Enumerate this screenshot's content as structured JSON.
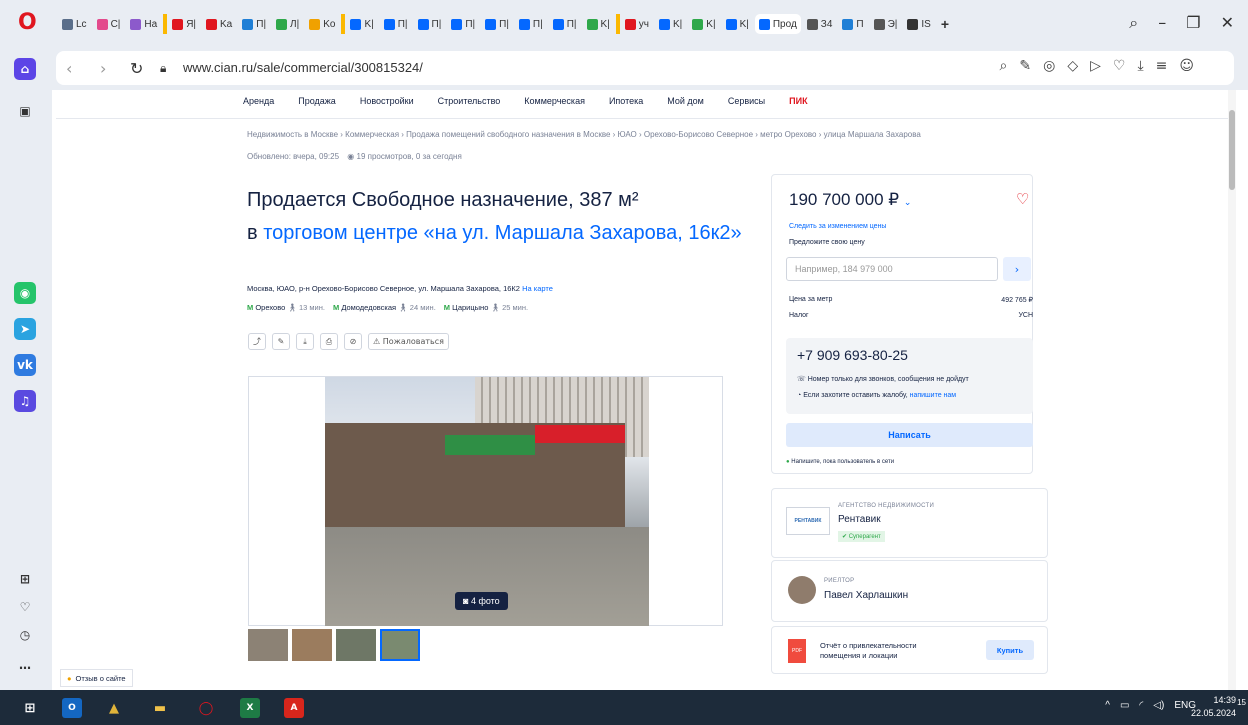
{
  "browser": {
    "tabs": [
      {
        "label": "Lc",
        "color": "#5a6e8a"
      },
      {
        "label": "C|",
        "color": "#e34a8c"
      },
      {
        "label": "Ha",
        "color": "#8c5acb"
      },
      {
        "label": "Я|",
        "color": "#e0161f"
      },
      {
        "label": "Ka",
        "color": "#e0161f"
      },
      {
        "label": "П|",
        "color": "#1f7fd6"
      },
      {
        "label": "Л|",
        "color": "#2ea84a"
      },
      {
        "label": "Ko",
        "color": "#f0a100"
      },
      {
        "label": "K|",
        "color": "#0468ff"
      },
      {
        "label": "П|",
        "color": "#0468ff"
      },
      {
        "label": "П|",
        "color": "#0468ff"
      },
      {
        "label": "П|",
        "color": "#0468ff"
      },
      {
        "label": "П|",
        "color": "#0468ff"
      },
      {
        "label": "П|",
        "color": "#0468ff"
      },
      {
        "label": "П|",
        "color": "#0468ff"
      },
      {
        "label": "K|",
        "color": "#2ea84a"
      },
      {
        "label": "уч",
        "color": "#e0161f"
      },
      {
        "label": "K|",
        "color": "#0468ff"
      },
      {
        "label": "K|",
        "color": "#2ea84a"
      },
      {
        "label": "K|",
        "color": "#0468ff"
      },
      {
        "label": "Прод",
        "color": "#0468ff"
      },
      {
        "label": "З4",
        "color": "#555555"
      },
      {
        "label": "П",
        "color": "#1f7fd6"
      },
      {
        "label": "Э|",
        "color": "#555555"
      },
      {
        "label": "IS",
        "color": "#333333"
      }
    ],
    "url": "www.cian.ru/sale/commercial/300815324/"
  },
  "menu": [
    "Аренда",
    "Продажа",
    "Новостройки",
    "Строительство",
    "Коммерческая",
    "Ипотека",
    "Мой дом",
    "Сервисы"
  ],
  "menu_pik": "ПИК",
  "breadcrumbs": "Недвижимость в Москве  ›  Коммерческая  ›  Продажа помещений свободного назначения в Москве  ›  ЮАО  ›  Орехово-Борисово Северное  ›  метро Орехово  ›  улица Маршала Захарова",
  "updated": "Обновлено: вчера, 09:25",
  "views": "19 просмотров, 0 за сегодня",
  "title_line1": "Продается Свободное назначение, 387 м²",
  "title_prefix": "в ",
  "title_link": "торговом центре «на ул. Маршала Захарова, 16к2»",
  "address": "Москва, ЮАО, р-н Орехово-Борисово Северное, ул. Маршала Захарова, 16К2",
  "on_map": "На карте",
  "metro": [
    {
      "name": "Орехово",
      "time": "13 мин."
    },
    {
      "name": "Домодедовская",
      "time": "24 мин."
    },
    {
      "name": "Царицыно",
      "time": "25 мин."
    }
  ],
  "complain": "Пожаловаться",
  "photo_count": "4 фото",
  "feedback": "Отзыв о сайте",
  "price": "190 700 000 ₽",
  "follow_price": "Следить за изменением цены",
  "offer_label": "Предложите свою цену",
  "offer_placeholder": "Например, 184 979 000",
  "price_per_m_label": "Цена за метр",
  "price_per_m": "492 765 ₽",
  "tax_label": "Налог",
  "tax": "УСН",
  "phone": "+7 909 693-80-25",
  "phone_note": "Номер только для звонков, сообщения не дойдут",
  "complaint_note": "Если захотите оставить жалобу,",
  "complaint_link": "напишите нам",
  "write_btn": "Написать",
  "online_note": "Напишите, пока пользователь в сети",
  "agency_type": "АГЕНТСТВО НЕДВИЖИМОСТИ",
  "agency_name": "Рентавик",
  "agency_logo": "РЕНТАВИК",
  "agency_badge": "Суперагент",
  "realtor_type": "РИЕЛТОР",
  "realtor_name": "Павел Харлашкин",
  "report_text": "Отчёт о привлекательности помещения и локации",
  "report_icon": "PDF",
  "buy_btn": "Купить",
  "taskbar": {
    "lang": "ENG",
    "time": "14:39",
    "date": "22.05.2024",
    "notif": "15"
  },
  "colors": {
    "accent": "#0468ff",
    "brand_red": "#e0161f",
    "metro_green": "#2ea84a",
    "text": "#152242"
  }
}
